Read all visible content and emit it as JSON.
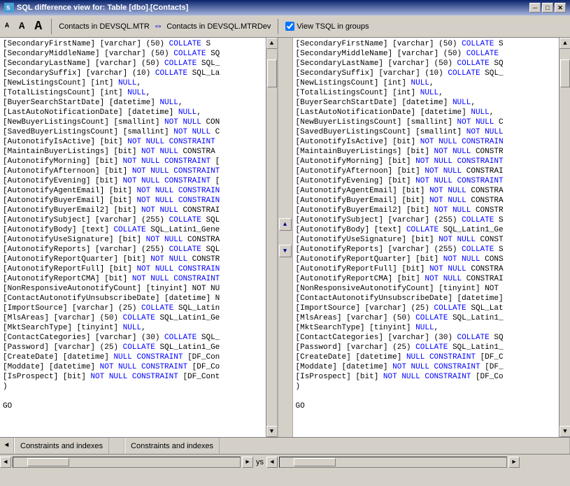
{
  "titleBar": {
    "title": "SQL difference view for: Table [dbo].[Contacts]",
    "closeBtn": "✕",
    "maxBtn": "□",
    "minBtn": "─"
  },
  "toolbar": {
    "fontSmall": "A",
    "fontMedium": "A",
    "fontLarge": "A",
    "leftLabel": "Contacts in DEVSQL.MTR",
    "rightLabel": "Contacts in DEVSQL.MTRDev",
    "checkboxLabel": "View TSQL in groups"
  },
  "leftCode": [
    "[SecondaryFirstName] [varchar] (50) COLLATE S",
    "[SecondaryMiddleName] [varchar] (50) COLLATE SQ",
    "[SecondaryLastName] [varchar] (50) COLLATE SQL_",
    "[SecondarySuffix] [varchar] (10) COLLATE SQL_La",
    "[NewListingsCount] [int] NULL,",
    "[TotalListingsCount] [int] NULL,",
    "[BuyerSearchStartDate] [datetime] NULL,",
    "[LastAutoNotificationDate] [datetime] NULL,",
    "[NewBuyerListingsCount] [smallint] NOT NULL CON",
    "[SavedBuyerListingsCount] [smallint] NOT NULL C",
    "[AutonotifyIsActive] [bit] NOT NULL CONSTRAINT",
    "[MaintainBuyerListings] [bit] NOT NULL CONSTRA",
    "[AutonotifyMorning] [bit] NOT NULL CONSTRAINT [",
    "[AutonotifyAfternoon] [bit] NOT NULL CONSTRAINT",
    "[AutonotifyEvening] [bit] NOT NULL CONSTRAINT [",
    "[AutonotifyAgentEmail] [bit] NOT NULL CONSTRAIN",
    "[AutonotifyBuyerEmail] [bit] NOT NULL CONSTRAIN",
    "[AutonotifyBuyerEmail2] [bit] NOT NULL CONSTRAI",
    "[AutonotifySubject] [varchar] (255) COLLATE SQL",
    "[AutonotifyBody] [text] COLLATE SQL_Latin1_Gene",
    "[AutonotifyUseSignature] [bit] NOT NULL CONSTRA",
    "[AutonotifyReports] [varchar] (255) COLLATE SQL",
    "[AutonotifyReportQuarter] [bit] NOT NULL CONSTR",
    "[AutonotifyReportFull] [bit] NOT NULL CONSTRAIN",
    "[AutonotifyReportCMA] [bit] NOT NULL CONSTRAINT",
    "[NonResponsiveAutonotifyCount] [tinyint] NOT NU",
    "[ContactAutonotifyUnsubscribeDate] [datetime] N",
    "[ImportSource] [varchar] (25) COLLATE SQL_Latin",
    "[MlsAreas] [varchar] (50) COLLATE SQL_Latin1_Ge",
    "[MktSearchType] [tinyint] NULL,",
    "[ContactCategories] [varchar] (30) COLLATE SQL_",
    "[Password] [varchar] (25) COLLATE SQL_Latin1_Ge",
    "[CreateDate] [datetime] NULL CONSTRAINT [DF_Con",
    "[Moddate] [datetime] NOT NULL CONSTRAINT [DF_Co",
    "[IsProspect] [bit] NOT NULL CONSTRAINT [DF_Cont",
    ")",
    "",
    "GO"
  ],
  "rightCode": [
    "[SecondaryFirstName] [varchar] (50) COLLATE S",
    "[SecondaryMiddleName] [varchar] (50) COLLATE",
    "[SecondaryLastName] [varchar] (50) COLLATE SQ",
    "[SecondarySuffix] [varchar] (10) COLLATE SQL_",
    "[NewListingsCount] [int] NULL,",
    "[TotalListingsCount] [int] NULL,",
    "[BuyerSearchStartDate] [datetime] NULL,",
    "[LastAutoNotificationDate] [datetime] NULL,",
    "[NewBuyerListingsCount] [smallint] NOT NULL C",
    "[SavedBuyerListingsCount] [smallint] NOT NULL",
    "[AutonotifyIsActive] [bit] NOT NULL CONSTRAIN",
    "[MaintainBuyerListings] [bit] NOT NULL CONSTR",
    "[AutonotifyMorning] [bit] NOT NULL CONSTRAINT",
    "[AutonotifyAfternoon] [bit] NOT NULL CONSTRAI",
    "[AutonotifyEvening] [bit] NOT NULL CONSTRAINT",
    "[AutonotifyAgentEmail] [bit] NOT NULL CONSTRA",
    "[AutonotifyBuyerEmail] [bit] NOT NULL CONSTRA",
    "[AutonotifyBuyerEmail2] [bit] NOT NULL CONSTR",
    "[AutonotifySubject] [varchar] (255) COLLATE S",
    "[AutonotifyBody] [text] COLLATE SQL_Latin1_Ge",
    "[AutonotifyUseSignature] [bit] NOT NULL CONST",
    "[AutonotifyReports] [varchar] (255) COLLATE S",
    "[AutonotifyReportQuarter] [bit] NOT NULL CONS",
    "[AutonotifyReportFull] [bit] NOT NULL CONSTRA",
    "[AutonotifyReportCMA] [bit] NOT NULL CONSTRAI",
    "[NonResponsiveAutonotifyCount] [tinyint] NOT",
    "[ContactAutonotifyUnsubscribeDate] [datetime]",
    "[ImportSource] [varchar] (25) COLLATE SQL_Lat",
    "[MlsAreas] [varchar] (50) COLLATE SQL_Latin1_",
    "[MktSearchType] [tinyint] NULL,",
    "[ContactCategories] [varchar] (30) COLLATE SQ",
    "[Password] [varchar] (25) COLLATE SQL_Latin1_",
    "[CreateDate] [datetime] NULL CONSTRAINT [DF_C",
    "[Moddate] [datetime] NOT NULL CONSTRAINT [DF_",
    "[IsProspect] [bit] NOT NULL CONSTRAINT [DF_Co",
    ")",
    "",
    "GO"
  ],
  "bottomTabs": {
    "leftTab": "Constraints and indexes",
    "rightTab": "Constraints and indexes"
  },
  "statusBar": {
    "ysLabel": "ys"
  }
}
